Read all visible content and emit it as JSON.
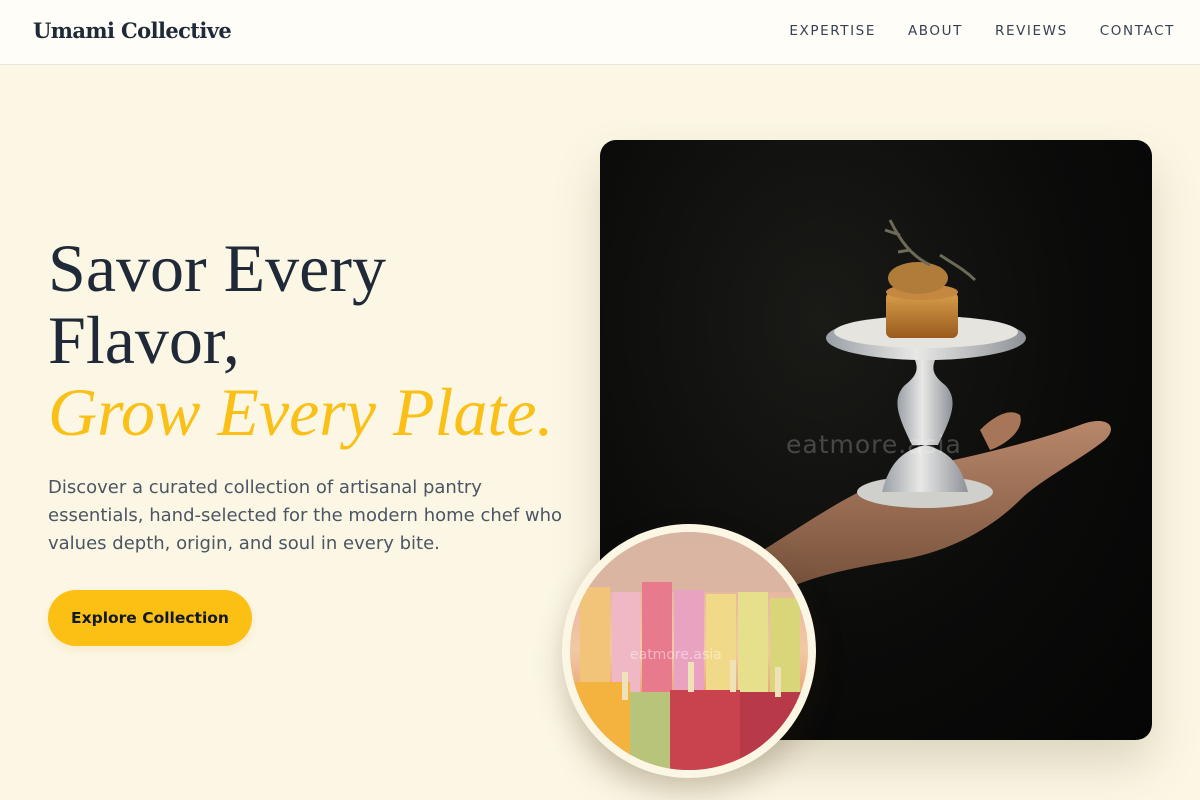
{
  "header": {
    "logo": "Umami Collective",
    "nav": [
      "EXPERTISE",
      "ABOUT",
      "REVIEWS",
      "CONTACT"
    ]
  },
  "hero": {
    "title_line1": "Savor Every",
    "title_line2": "Flavor,",
    "title_accent": "Grow Every Plate.",
    "description": "Discover a curated collection of artisanal pantry essentials, hand-selected for the modern home chef who values depth, origin, and soul in every bite.",
    "cta_label": "Explore Collection"
  },
  "images": {
    "main_watermark": "eatmore.asia",
    "circle_watermark": "eatmore.asia"
  },
  "colors": {
    "background": "#fcf7e5",
    "accent": "#fac017",
    "text_dark": "#1f2937",
    "text_muted": "#4b5563"
  }
}
